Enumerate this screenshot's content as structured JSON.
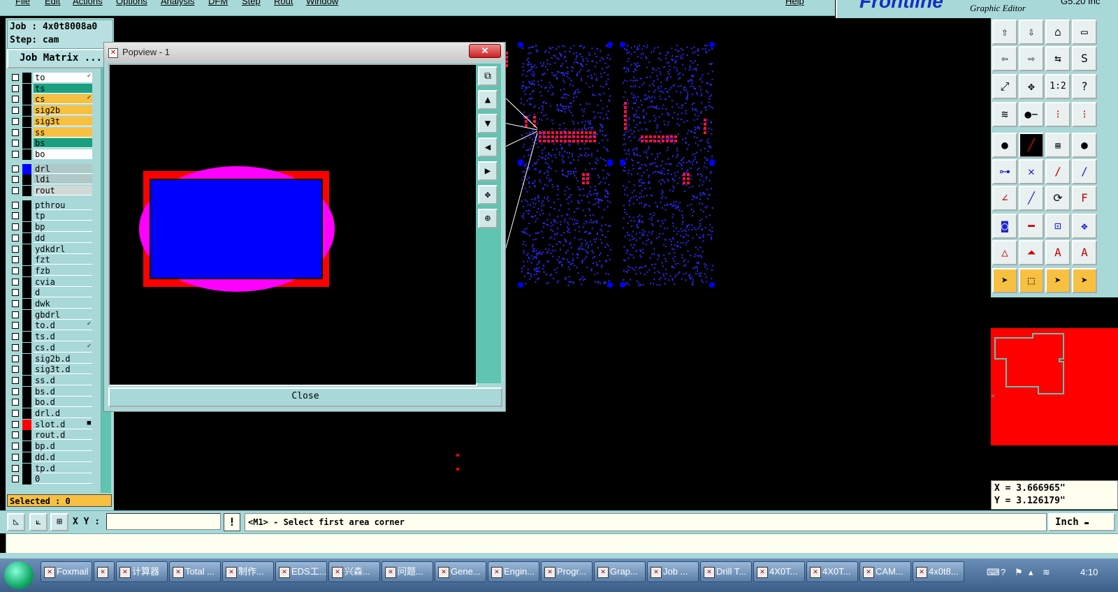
{
  "menu": {
    "items": [
      "File",
      "Edit",
      "Actions",
      "Options",
      "Analysis",
      "DFM",
      "Step",
      "Rout",
      "Window"
    ],
    "help": "Help"
  },
  "brand": {
    "logo": "Frontline",
    "subtitle": "Graphic Editor",
    "version": "G5.20 Inc"
  },
  "job": {
    "job_line": "Job : 4x0t8008a0",
    "step_line": "Step: cam",
    "matrix_button": "Job Matrix ..."
  },
  "layers": [
    {
      "name": "to",
      "color": "#ffffff",
      "mark": "✓"
    },
    {
      "name": "ts",
      "color": "#1aa080",
      "mark": ""
    },
    {
      "name": "cs",
      "color": "#f8c040",
      "mark": "✓"
    },
    {
      "name": "sig2b",
      "color": "#f8c040",
      "mark": ""
    },
    {
      "name": "sig3t",
      "color": "#f8c040",
      "mark": ""
    },
    {
      "name": "ss",
      "color": "#f8c040",
      "mark": ""
    },
    {
      "name": "bs",
      "color": "#1aa080",
      "mark": ""
    },
    {
      "name": "bo",
      "color": "#ffffff",
      "mark": ""
    },
    {
      "name": "drl",
      "color": "#b0c8c8",
      "mark": ""
    },
    {
      "name": "ldi",
      "color": "#b0c8c8",
      "mark": ""
    },
    {
      "name": "rout",
      "color": "#d0d8d8",
      "mark": ""
    },
    {
      "name": "pthrou",
      "color": "#a8d8d8",
      "mark": ""
    },
    {
      "name": "tp",
      "color": "#a8d8d8",
      "mark": ""
    },
    {
      "name": "bp",
      "color": "#a8d8d8",
      "mark": ""
    },
    {
      "name": "dd",
      "color": "#a8d8d8",
      "mark": ""
    },
    {
      "name": "ydkdrl",
      "color": "#a8d8d8",
      "mark": ""
    },
    {
      "name": "fzt",
      "color": "#a8d8d8",
      "mark": ""
    },
    {
      "name": "fzb",
      "color": "#a8d8d8",
      "mark": ""
    },
    {
      "name": "cvia",
      "color": "#a8d8d8",
      "mark": ""
    },
    {
      "name": "d",
      "color": "#a8d8d8",
      "mark": ""
    },
    {
      "name": "dwk",
      "color": "#a8d8d8",
      "mark": ""
    },
    {
      "name": "gbdrl",
      "color": "#a8d8d8",
      "mark": ""
    },
    {
      "name": "to.d",
      "color": "#a8d8d8",
      "mark": "✓"
    },
    {
      "name": "ts.d",
      "color": "#a8d8d8",
      "mark": ""
    },
    {
      "name": "cs.d",
      "color": "#a8d8d8",
      "mark": "✓"
    },
    {
      "name": "sig2b.d",
      "color": "#a8d8d8",
      "mark": ""
    },
    {
      "name": "sig3t.d",
      "color": "#a8d8d8",
      "mark": ""
    },
    {
      "name": "ss.d",
      "color": "#a8d8d8",
      "mark": ""
    },
    {
      "name": "bs.d",
      "color": "#a8d8d8",
      "mark": ""
    },
    {
      "name": "bo.d",
      "color": "#a8d8d8",
      "mark": ""
    },
    {
      "name": "drl.d",
      "color": "#a8d8d8",
      "mark": ""
    },
    {
      "name": "slot.d",
      "color": "#a8d8d8",
      "mark": "■"
    },
    {
      "name": "rout.d",
      "color": "#a8d8d8",
      "mark": ""
    },
    {
      "name": "bp.d",
      "color": "#a8d8d8",
      "mark": ""
    },
    {
      "name": "dd.d",
      "color": "#a8d8d8",
      "mark": ""
    },
    {
      "name": "tp.d",
      "color": "#a8d8d8",
      "mark": ""
    },
    {
      "name": "0",
      "color": "#a8d8d8",
      "mark": ""
    }
  ],
  "selected": "Selected : 0",
  "popview": {
    "title": "Popview - 1",
    "close_label": "Close"
  },
  "coords": {
    "x": "X = 3.666965\"",
    "y": "Y = 3.126179\""
  },
  "cmd": {
    "xy_label": "X Y :",
    "xy_value": "",
    "bang": "!",
    "prompt": "<M1> - Select first area corner",
    "unit": "Inch"
  },
  "taskbar": {
    "tasks": [
      "Foxmail",
      "",
      "计算器",
      "Total ...",
      "制作...",
      "EDS工...",
      "兴森...",
      "问题...",
      "Gene...",
      "Engin...",
      "Progr...",
      "Grap...",
      "Job ...",
      "Drill T...",
      "4X0T...",
      "4X0T...",
      "CAM...",
      "4x0t8..."
    ],
    "clock": "4:10"
  },
  "colors": {
    "panel": "#a8d8d8",
    "pad_blue": "#0000ff",
    "outline_red": "#ff0000",
    "overlap_magenta": "#ff00ff",
    "highlight": "#f8c040"
  }
}
